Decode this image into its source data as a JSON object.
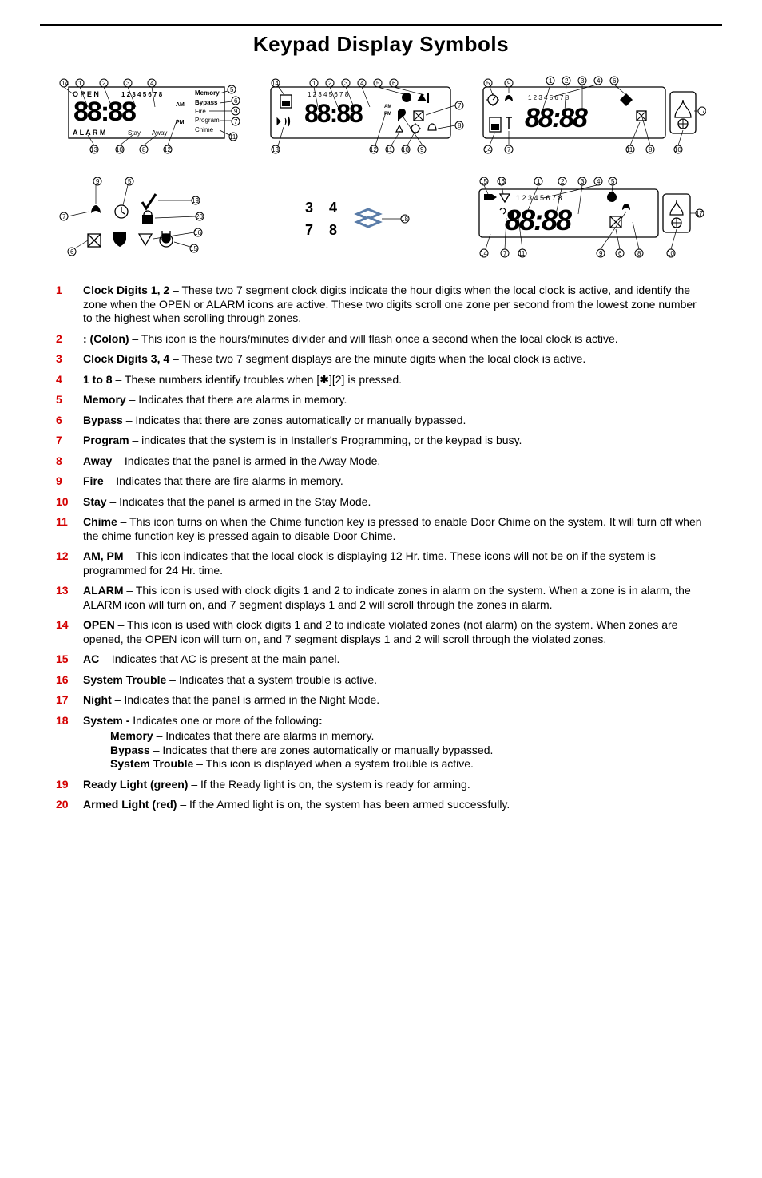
{
  "title": "Keypad Display Symbols",
  "svg_labels": {
    "panel1": {
      "memory": "Memory",
      "bypass": "Bypass",
      "fire": "Fire",
      "program": "Program",
      "chime": "Chime",
      "clock": "88:88",
      "open": "O P E N",
      "zones": "1 2 3 4 5 6 7 8",
      "am": "AM",
      "pm": "PM",
      "stay": "Stay",
      "away": "Away",
      "alarm": "A L A R M"
    },
    "panel2": {
      "zones": "1 2 3 4 5 6 7 8",
      "clock": "88:88",
      "am": "AM",
      "pm": "PM"
    },
    "panel3": {
      "zones": "1 2 3 4 5 6 7 8",
      "clock": "88:88"
    },
    "panel5": {
      "d3": "3",
      "d4": "4",
      "d7": "7",
      "d8": "8"
    },
    "panel6": {
      "zones": "1 2 3 4 5 6 7 8",
      "clock": "88:88"
    }
  },
  "items": [
    {
      "n": "1",
      "lead": "Clock Digits 1, 2",
      "text": " – These two 7 segment clock digits indicate the hour digits when the local clock is active, and identify the zone when the OPEN or ALARM icons are active. These two digits scroll one zone per second from the lowest zone number to the highest when scrolling through zones."
    },
    {
      "n": "2",
      "lead": ": (Colon)",
      "text": " – This icon is the hours/minutes divider and will flash once a second when the local clock is active."
    },
    {
      "n": "3",
      "lead": "Clock Digits 3, 4",
      "text": " – These two 7 segment displays are the minute digits when the local clock is active."
    },
    {
      "n": "4",
      "lead": "1 to 8",
      "text": " – These numbers identify troubles when [✱][2] is pressed."
    },
    {
      "n": "5",
      "lead": "Memory",
      "text": " –  Indicates that there are alarms in memory."
    },
    {
      "n": "6",
      "lead": "Bypass",
      "text": " –  Indicates that there are zones automatically or manually bypassed."
    },
    {
      "n": "7",
      "lead": "Program",
      "text": " – indicates that the system is in Installer's Programming, or the keypad is busy."
    },
    {
      "n": "8",
      "lead": "Away",
      "text": " – Indicates that the panel is armed in the Away Mode."
    },
    {
      "n": "9",
      "lead": "Fire",
      "text": " –  Indicates that there are fire alarms in memory."
    },
    {
      "n": "10",
      "lead": "Stay",
      "text": " – Indicates that the panel is armed in the Stay Mode."
    },
    {
      "n": "11",
      "lead": "Chime",
      "text": " – This icon turns on when the Chime function key is pressed to enable Door Chime on the system. It will turn off when the chime function key is pressed again to disable Door Chime."
    },
    {
      "n": "12",
      "lead": "AM, PM",
      "text": " – This icon indicates that the local clock is displaying 12 Hr. time.  These icons will not be on if the system is programmed for 24 Hr. time."
    },
    {
      "n": "13",
      "lead": "ALARM",
      "text": " – This icon is used with clock digits 1 and 2 to indicate zones in alarm on the system. When a zone is in alarm, the ALARM icon will turn on, and 7 segment displays 1 and 2 will scroll through the zones in alarm."
    },
    {
      "n": "14",
      "lead": "OPEN",
      "text": " – This icon is used with clock digits 1 and 2 to indicate violated zones (not alarm) on the system. When zones are opened, the OPEN icon will turn on, and 7 segment displays 1 and 2 will scroll through the violated zones."
    },
    {
      "n": "15",
      "lead": "AC",
      "text": " –  Indicates that AC is present at the main panel."
    },
    {
      "n": "16",
      "lead": "System Trouble",
      "text": " –  Indicates that a system trouble is active."
    },
    {
      "n": "17",
      "lead": "Night",
      "text": "  –  Indicates that the panel is armed in the Night Mode."
    },
    {
      "n": "18",
      "lead": "System -",
      "text": " Indicates one or more of the following",
      "sub": [
        {
          "lead": "Memory",
          "text": " –  Indicates that there are alarms in memory."
        },
        {
          "lead": "Bypass",
          "text": " –  Indicates that there are zones automatically or manually bypassed."
        },
        {
          "lead": "System Trouble",
          "text": " –  This icon is displayed when a system trouble is active."
        }
      ]
    },
    {
      "n": "19",
      "lead": "Ready Light (green)",
      "text": " –  If the Ready light is on, the system is ready for arming."
    },
    {
      "n": "20",
      "lead": "Armed Light (red)",
      "text": " –  If the Armed light is on, the system has been armed successfully."
    }
  ]
}
